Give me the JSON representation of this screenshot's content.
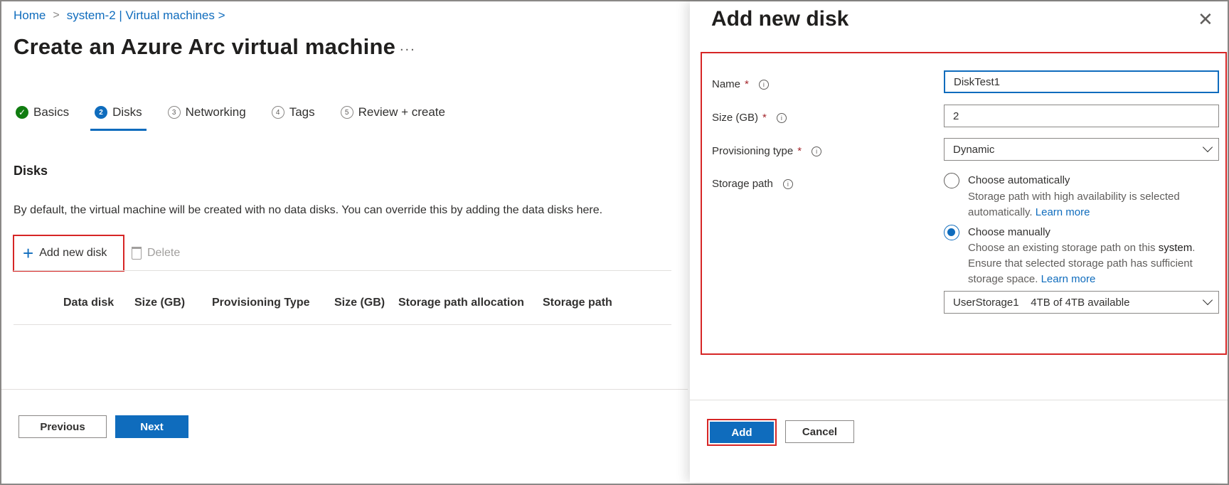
{
  "breadcrumb": {
    "home": "Home",
    "sep1": ">",
    "current": "system-2 | Virtual machines >"
  },
  "page": {
    "title": "Create an Azure Arc virtual machine",
    "more": "..."
  },
  "tabs": [
    {
      "label": "Basics",
      "marker": "✓"
    },
    {
      "label": "Disks",
      "marker": "2"
    },
    {
      "label": "Networking",
      "marker": "3"
    },
    {
      "label": "Tags",
      "marker": "4"
    },
    {
      "label": "Review + create",
      "marker": "5"
    }
  ],
  "disks": {
    "section_title": "Disks",
    "description": "By default, the virtual machine will be created with no data disks. You can override this by adding the data disks here.",
    "add_label": "Add new disk",
    "delete_label": "Delete",
    "columns": [
      "Data disk",
      "Size (GB)",
      "Provisioning Type",
      "Size (GB)",
      "Storage path allocation",
      "Storage path"
    ]
  },
  "footer": {
    "previous": "Previous",
    "next": "Next"
  },
  "panel": {
    "title": "Add new disk",
    "close": "✕",
    "name_label": "Name",
    "name_value": "DiskTest1",
    "size_label": "Size (GB)",
    "size_value": "2",
    "prov_label": "Provisioning type",
    "prov_value": "Dynamic",
    "storage_label": "Storage path",
    "required_mark": "*",
    "info_glyph": "i",
    "auto_label": "Choose automatically",
    "auto_desc": "Storage path with high availability is selected automatically.",
    "learn_more": "Learn more",
    "manual_label": "Choose manually",
    "manual_desc_1": "Choose an existing storage path on this",
    "manual_desc_sys": "system",
    "manual_desc_2": ". Ensure that selected storage path has sufficient storage space.",
    "storage_select": "UserStorage1    4TB of 4TB available",
    "add": "Add",
    "cancel": "Cancel"
  }
}
